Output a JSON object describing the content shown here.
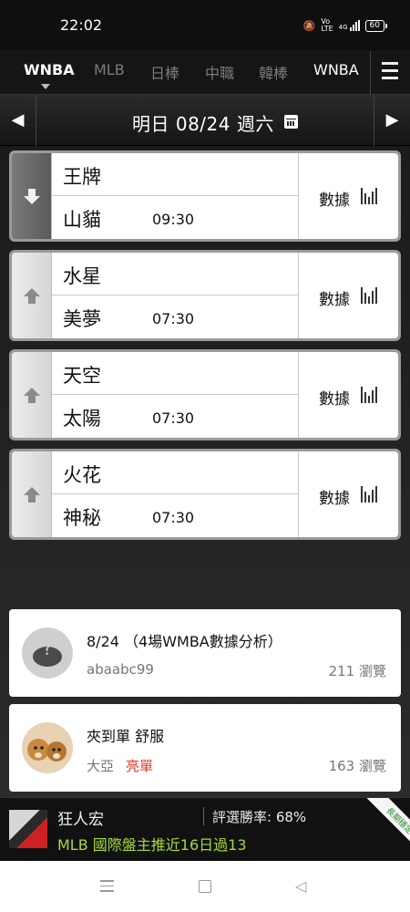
{
  "status_bar": {
    "time": "22:02",
    "battery": "60",
    "network": "4G"
  },
  "tabs": [
    {
      "label": "WNBA",
      "active": true
    },
    {
      "label": "MLB",
      "active": false
    },
    {
      "label": "日棒",
      "active": false
    },
    {
      "label": "中職",
      "active": false
    },
    {
      "label": "韓棒",
      "active": false
    },
    {
      "label": "WNBA",
      "active": false
    }
  ],
  "date_bar": {
    "label": "明日 08/24 週六"
  },
  "matches": [
    {
      "team_top": "王牌",
      "team_bottom": "山貓",
      "time": "09:30",
      "stats_label": "數據",
      "arrow": "down"
    },
    {
      "team_top": "水星",
      "team_bottom": "美夢",
      "time": "07:30",
      "stats_label": "數據",
      "arrow": "up"
    },
    {
      "team_top": "天空",
      "team_bottom": "太陽",
      "time": "07:30",
      "stats_label": "數據",
      "arrow": "up"
    },
    {
      "team_top": "火花",
      "team_bottom": "神秘",
      "time": "07:30",
      "stats_label": "數據",
      "arrow": "up"
    }
  ],
  "articles": [
    {
      "title": "8/24 （4場WMBA數據分析）",
      "author": "abaabc99",
      "tag": "",
      "views": "211 瀏覽"
    },
    {
      "title": "夾到單 舒服",
      "author": "大亞",
      "tag": "亮單",
      "views": "163 瀏覽"
    }
  ],
  "banner": {
    "name": "狂人宏",
    "rate": "評選勝率: 68%",
    "headline": "MLB 國際盤主推近16日過13",
    "ribbon": "長期穩定"
  },
  "colors": {
    "accent_green": "#a6d93b",
    "tag_red": "#e03a2e"
  }
}
